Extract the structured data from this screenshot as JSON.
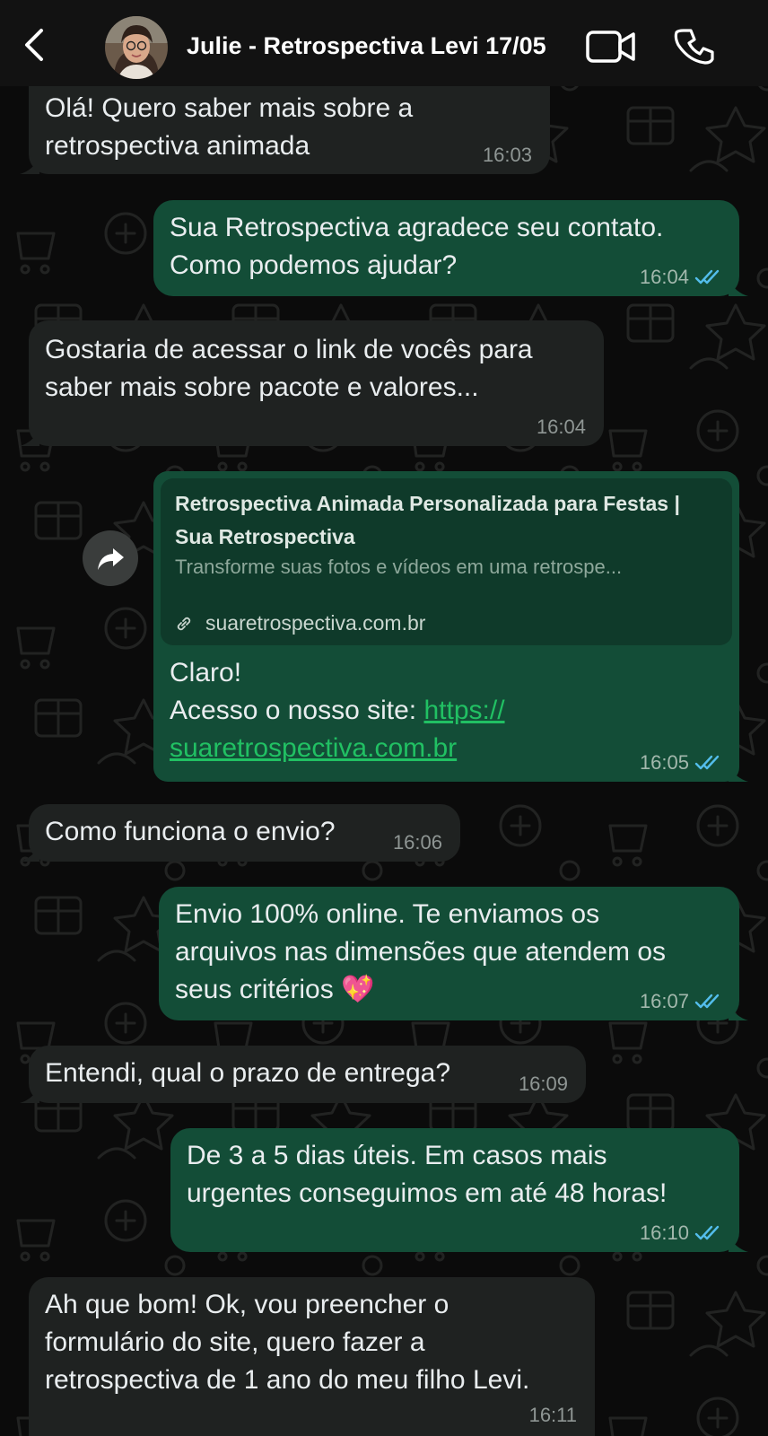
{
  "header": {
    "title": "Julie - Retrospectiva Levi 17/05"
  },
  "messages": [
    {
      "dir": "in",
      "lines": [
        "Olá! Quero saber mais sobre a",
        "retrospectiva animada"
      ],
      "time": "16:03"
    },
    {
      "dir": "out",
      "lines": [
        "Sua Retrospectiva agradece seu contato.",
        "Como podemos ajudar?"
      ],
      "time": "16:04"
    },
    {
      "dir": "in",
      "lines": [
        "Gostaria de acessar o link de vocês para",
        "saber mais sobre pacote e valores..."
      ],
      "time": "16:04"
    },
    {
      "dir": "out",
      "link_preview": {
        "title": "Retrospectiva Animada Personalizada para Festas | Sua Retrospectiva",
        "description": "Transforme suas fotos e vídeos em uma retrospe...",
        "domain": "suaretrospectiva.com.br"
      },
      "line1": "Claro!",
      "line2_prefix": "Acesso o nosso site: ",
      "link_part1": "https://",
      "link_part2": "suaretrospectiva.com.br",
      "time": "16:05"
    },
    {
      "dir": "in",
      "lines": [
        "Como funciona o envio?"
      ],
      "time": "16:06"
    },
    {
      "dir": "out",
      "lines": [
        "Envio 100% online. Te enviamos os",
        "arquivos nas dimensões que atendem os",
        "seus critérios 💖"
      ],
      "time": "16:07"
    },
    {
      "dir": "in",
      "lines": [
        "Entendi, qual o prazo de entrega?"
      ],
      "time": "16:09"
    },
    {
      "dir": "out",
      "lines": [
        "De 3 a 5 dias úteis. Em casos mais",
        "urgentes conseguimos em até 48 horas!"
      ],
      "time": "16:10"
    },
    {
      "dir": "in",
      "lines": [
        "Ah que bom! Ok, vou preencher o",
        "formulário do site, quero fazer a",
        "retrospectiva de 1 ano do meu filho Levi."
      ],
      "time": "16:11"
    }
  ],
  "icons": {
    "back": "chevron-left-icon",
    "video": "video-camera-icon",
    "call": "phone-icon",
    "forward": "forward-arrow-icon",
    "read": "double-check-icon"
  },
  "colors": {
    "incoming_bubble": "#1f2221",
    "outgoing_bubble": "#134d37",
    "read_ticks": "#53bdeb",
    "link_text": "#21c063"
  }
}
